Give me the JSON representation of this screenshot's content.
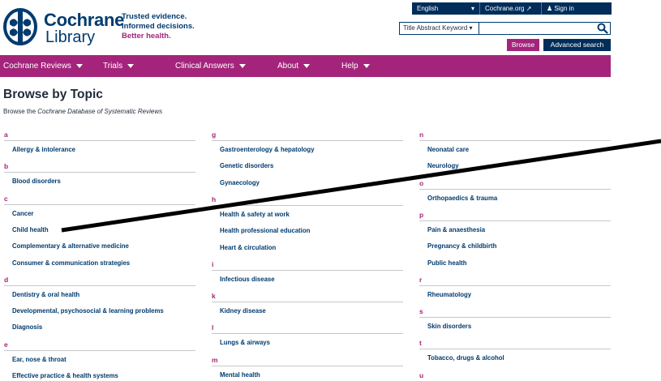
{
  "header": {
    "logo_line1": "Cochrane",
    "logo_line2": "Library",
    "tagline": [
      "Trusted evidence.",
      "Informed decisions.",
      "Better health."
    ],
    "language": "English",
    "site_link": "Cochrane.org",
    "sign_in": "Sign in",
    "search_scope": "Title Abstract Keyword",
    "search_value": "",
    "browse_button": "Browse",
    "advanced_search_button": "Advanced search"
  },
  "nav": {
    "items": [
      {
        "label": "Cochrane Reviews"
      },
      {
        "label": "Trials"
      },
      {
        "label": "Clinical Answers"
      },
      {
        "label": "About"
      },
      {
        "label": "Help"
      }
    ]
  },
  "main": {
    "title": "Browse by Topic",
    "subtitle_prefix": "Browse the ",
    "subtitle_italic": "Cochrane Database of Systematic Reviews"
  },
  "columns": [
    [
      {
        "letter": "a",
        "topics": [
          "Allergy & intolerance"
        ]
      },
      {
        "letter": "b",
        "topics": [
          "Blood disorders"
        ]
      },
      {
        "letter": "c",
        "topics": [
          "Cancer",
          "Child health",
          "Complementary & alternative medicine",
          "Consumer & communication strategies"
        ]
      },
      {
        "letter": "d",
        "topics": [
          "Dentistry & oral health",
          "Developmental, psychosocial & learning problems",
          "Diagnosis"
        ]
      },
      {
        "letter": "e",
        "topics": [
          "Ear, nose & throat",
          "Effective practice & health systems"
        ]
      }
    ],
    [
      {
        "letter": "g",
        "topics": [
          "Gastroenterology & hepatology",
          "Genetic disorders",
          "Gynaecology"
        ]
      },
      {
        "letter": "h",
        "topics": [
          "Health & safety at work",
          "Health professional education",
          "Heart & circulation"
        ]
      },
      {
        "letter": "i",
        "topics": [
          "Infectious disease"
        ]
      },
      {
        "letter": "k",
        "topics": [
          "Kidney disease"
        ]
      },
      {
        "letter": "l",
        "topics": [
          "Lungs & airways"
        ]
      },
      {
        "letter": "m",
        "topics": [
          "Mental health"
        ]
      }
    ],
    [
      {
        "letter": "n",
        "topics": [
          "Neonatal care",
          "Neurology"
        ]
      },
      {
        "letter": "o",
        "topics": [
          "Orthopaedics & trauma"
        ]
      },
      {
        "letter": "p",
        "topics": [
          "Pain & anaesthesia",
          "Pregnancy & childbirth",
          "Public health"
        ]
      },
      {
        "letter": "r",
        "topics": [
          "Rheumatology"
        ]
      },
      {
        "letter": "s",
        "topics": [
          "Skin disorders"
        ]
      },
      {
        "letter": "t",
        "topics": [
          "Tobacco, drugs & alcohol"
        ]
      },
      {
        "letter": "u",
        "topics": []
      }
    ]
  ],
  "colors": {
    "brand_blue": "#003b6f",
    "brand_purple": "#a4247b",
    "dark_navy": "#002d5a"
  }
}
